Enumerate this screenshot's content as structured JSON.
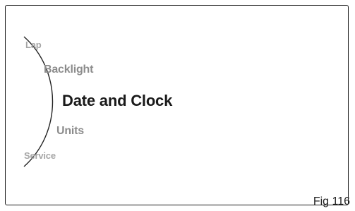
{
  "menu": {
    "items": [
      {
        "label": "Lap",
        "state": "far"
      },
      {
        "label": "Backlight",
        "state": "near"
      },
      {
        "label": "Date and Clock",
        "state": "selected"
      },
      {
        "label": "Units",
        "state": "near"
      },
      {
        "label": "Service",
        "state": "far"
      }
    ]
  },
  "caption": "Fig 116",
  "colors": {
    "selected_text": "#1a1a1a",
    "near_text": "#8c8c8c",
    "far_text": "#a6a6a6",
    "arc_stroke": "#222222",
    "frame_stroke": "#1a1a1a"
  }
}
